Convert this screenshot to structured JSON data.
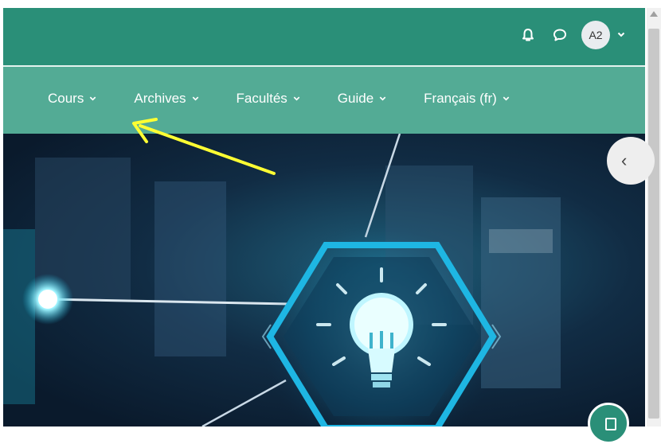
{
  "header": {
    "avatar_initials": "A2",
    "icons": [
      "bell-icon",
      "chat-icon",
      "chevron-down-icon"
    ]
  },
  "nav": {
    "items": [
      {
        "label": "Cours",
        "chevron": "⌄"
      },
      {
        "label": "Archives",
        "chevron": "⌄"
      },
      {
        "label": "Facultés",
        "chevron": "⌄"
      },
      {
        "label": "Guide",
        "chevron": "⌄"
      },
      {
        "label": "Français (fr)",
        "chevron": "⌄"
      }
    ]
  },
  "drawer_toggle": {
    "glyph": "‹"
  },
  "colors": {
    "topbar": "#2a8f78",
    "navbar": "#53ab95",
    "annotation_arrow": "#ffff33"
  }
}
